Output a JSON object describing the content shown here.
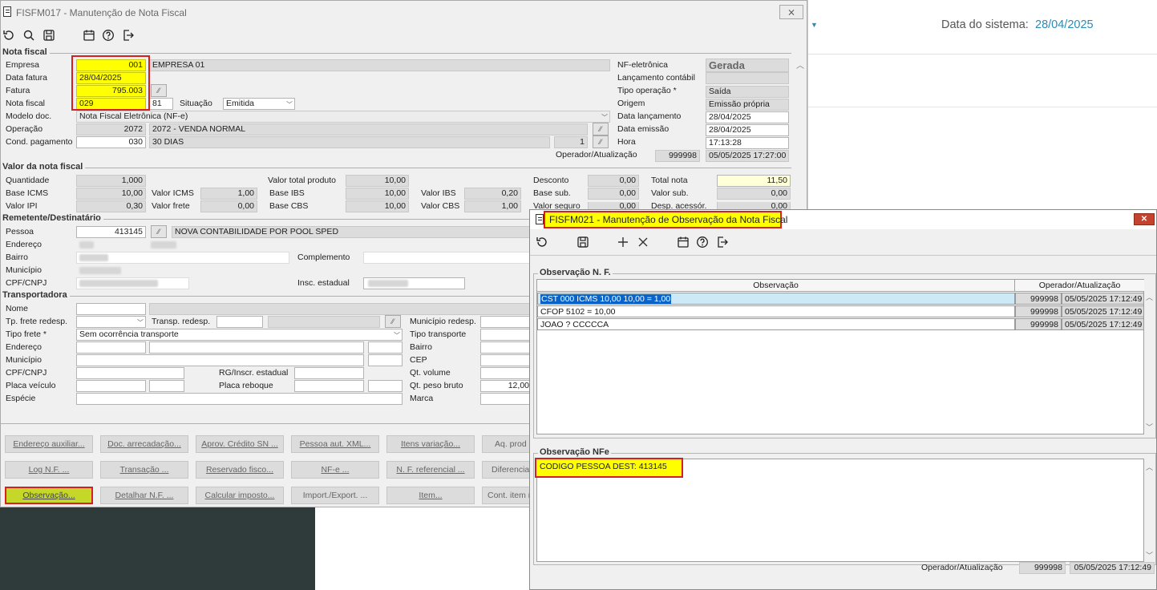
{
  "bg": {
    "date_label": "Data do sistema:",
    "date_value": "28/04/2025"
  },
  "main": {
    "title": "FISFM017 - Manutenção de Nota Fiscal",
    "close": "⨯",
    "sections": {
      "nota": "Nota fiscal",
      "valor": "Valor da nota fiscal",
      "rem": "Remetente/Destinatário",
      "transp": "Transportadora"
    },
    "nota": {
      "empresa_label": "Empresa",
      "empresa_code": "001",
      "empresa_name": "EMPRESA 01",
      "data_fatura_label": "Data fatura",
      "data_fatura": "28/04/2025",
      "fatura_label": "Fatura",
      "fatura": "795.003",
      "nota_label": "Nota fiscal",
      "nota": "029",
      "serie": "81",
      "situacao_label": "Situação",
      "situacao": "Emitida",
      "modelo_label": "Modelo doc.",
      "modelo": "Nota Fiscal Eletrônica (NF-e)",
      "operacao_label": "Operação",
      "operacao_code": "2072",
      "operacao_desc": "2072 - VENDA NORMAL",
      "cond_label": "Cond. pagamento",
      "cond_code": "030",
      "cond_desc": "30 DIAS",
      "parcelas": "1",
      "nfe_label": "NF-eletrônica",
      "nfe": "Gerada",
      "lanc_cont_label": "Lançamento contábil",
      "tipo_op_label": "Tipo operação *",
      "tipo_op": "Saída",
      "origem_label": "Origem",
      "origem": "Emissão própria",
      "data_lanc_label": "Data lançamento",
      "data_lanc": "28/04/2025",
      "data_emis_label": "Data emissão",
      "data_emis": "28/04/2025",
      "hora_label": "Hora",
      "hora": "17:13:28",
      "op_label": "Operador/Atualização",
      "op_code": "999998",
      "op_date": "05/05/2025 17:27:00"
    },
    "valor": {
      "qtd_label": "Quantidade",
      "qtd": "1,000",
      "vtp_label": "Valor total produto",
      "vtp": "10,00",
      "desc_label": "Desconto",
      "desc": "0,00",
      "total_label": "Total nota",
      "total": "11,50",
      "bicms_label": "Base ICMS",
      "bicms": "10,00",
      "vicms_label": "Valor ICMS",
      "vicms": "1,00",
      "bibs_label": "Base IBS",
      "bibs": "10,00",
      "vibs_label": "Valor IBS",
      "vibs": "0,20",
      "bsub_label": "Base sub.",
      "bsub": "0,00",
      "vsub_label": "Valor sub.",
      "vsub": "0,00",
      "vipi_label": "Valor IPI",
      "vipi": "0,30",
      "vfrete_label": "Valor frete",
      "vfrete": "0,00",
      "bcbs_label": "Base CBS",
      "bcbs": "10,00",
      "vcbs_label": "Valor CBS",
      "vcbs": "1,00",
      "vseg_label": "Valor seguro",
      "vseg": "0,00",
      "desp_label": "Desp. acessór.",
      "desp": "0,00"
    },
    "rem": {
      "pessoa_label": "Pessoa",
      "pessoa": "413145",
      "pessoa_name": "NOVA CONTABILIDADE POR POOL SPED",
      "end_label": "Endereço",
      "bairro_label": "Bairro",
      "compl_label": "Complemento",
      "mun_label": "Município",
      "cpf_label": "CPF/CNPJ",
      "insc_label": "Insc. estadual"
    },
    "transp": {
      "nome_label": "Nome",
      "tp_frete_redesp_label": "Tp. frete redesp.",
      "transp_redesp_label": "Transp. redesp.",
      "mun_redesp_label": "Município redesp.",
      "tipo_frete_label": "Tipo frete *",
      "tipo_frete": "Sem ocorrência transporte",
      "tipo_transp_label": "Tipo transporte",
      "end_label": "Endereço",
      "bairro_label": "Bairro",
      "mun_label": "Município",
      "cep_label": "CEP",
      "cpf_label": "CPF/CNPJ",
      "rg_label": "RG/Inscr. estadual",
      "qtvol_label": "Qt. volume",
      "placa_label": "Placa veículo",
      "placa_reb_label": "Placa reboque",
      "qtpeso_label": "Qt. peso bruto",
      "qtpeso": "12,00",
      "especie_label": "Espécie",
      "marca_label": "Marca"
    },
    "buttons": [
      [
        "Endereço auxiliar...",
        "Doc. arrecadação...",
        "Aprov. Crédito SN ...",
        "Pessoa aut. XML...",
        "Itens variação...",
        "Aq. prod"
      ],
      [
        "Log N.F. ...",
        "Transação ...",
        "Reservado fisco...",
        "NF-e ...",
        "N. F. referencial ...",
        "Diferencia"
      ],
      [
        "Observação...",
        "Detalhar N.F. ...",
        "Calcular imposto...",
        "Import./Export. ...",
        "Item...",
        "Cont. item r"
      ]
    ]
  },
  "obs": {
    "title": "FISFM021 - Manutenção de Observação da Nota Fiscal",
    "close": "✕",
    "section1": "Observação N. F.",
    "col_obs": "Observação",
    "col_op": "Operador/Atualização",
    "rows": [
      {
        "obs": "CST 000 ICMS 10,00 10,00 = 1,00",
        "code": "999998",
        "date": "05/05/2025 17:12:49"
      },
      {
        "obs": "CFOP 5102 = 10,00",
        "code": "999998",
        "date": "05/05/2025 17:12:49"
      },
      {
        "obs": "JOAO ? CCCCCA",
        "code": "999998",
        "date": "05/05/2025 17:12:49"
      }
    ],
    "section2": "Observação NFe",
    "nfe_text": "CODIGO PESSOA DEST: 413145",
    "op_label": "Operador/Atualização",
    "op_code": "999998",
    "op_date": "05/05/2025 17:12:49"
  }
}
